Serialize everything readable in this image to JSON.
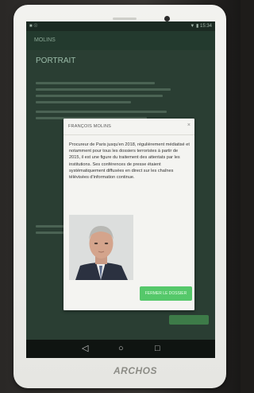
{
  "status": {
    "left": "■ ☉",
    "right": "▼ ▮ 15:34"
  },
  "app": {
    "title": "MOLINS"
  },
  "content": {
    "title": "PORTRAIT"
  },
  "dialog": {
    "title": "FRANÇOIS MOLINS",
    "close": "×",
    "body": "Procureur de Paris jusqu'en 2018, régulièrement médiatisé et notamment pour tous les dossiers terroristes à partir de 2015, il est une figure du traitement des attentats par les institutions. Ses conférences de presse étaient systématiquement diffusées en direct sur les chaînes télévisées d'information continue.",
    "button": "FERMER LE DOSSIER"
  },
  "nav": {
    "back": "◁",
    "home": "○",
    "recent": "□"
  },
  "brand": "ARCHOS",
  "colors": {
    "accent": "#55c86a",
    "tablet": "#eeeeea",
    "screen_bg": "#2a3e33"
  }
}
